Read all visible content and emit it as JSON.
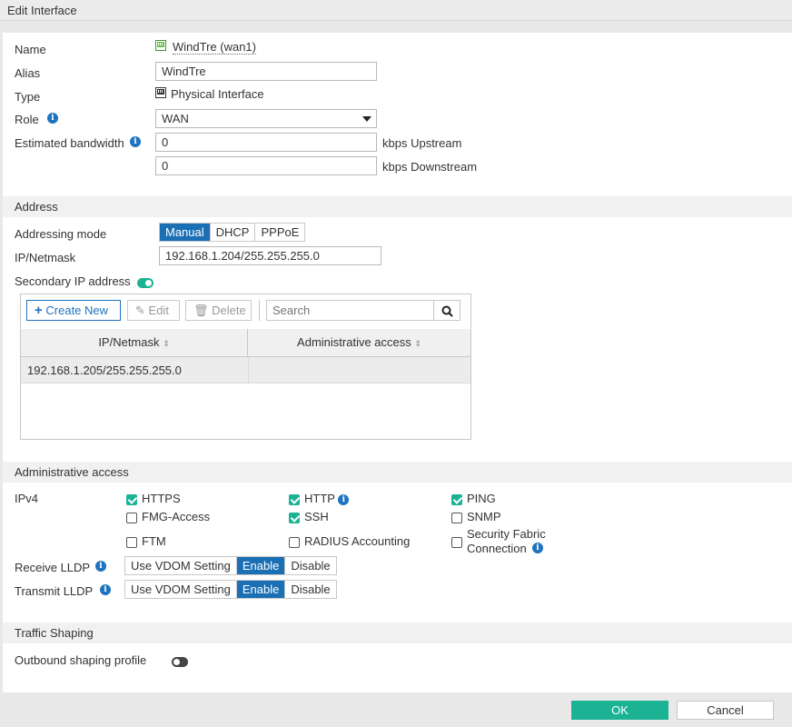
{
  "window": {
    "title": "Edit Interface"
  },
  "general": {
    "name_label": "Name",
    "name_value": "WindTre (wan1)",
    "alias_label": "Alias",
    "alias_value": "WindTre",
    "type_label": "Type",
    "type_value": "Physical Interface",
    "role_label": "Role",
    "role_value": "WAN",
    "bandwidth_label": "Estimated bandwidth",
    "upstream_value": "0",
    "upstream_unit": "kbps Upstream",
    "downstream_value": "0",
    "downstream_unit": "kbps Downstream"
  },
  "address": {
    "section_title": "Address",
    "mode_label": "Addressing mode",
    "modes": [
      "Manual",
      "DHCP",
      "PPPoE"
    ],
    "active_mode": "Manual",
    "ipnetmask_label": "IP/Netmask",
    "ipnetmask_value": "192.168.1.204/255.255.255.0",
    "secondary_label": "Secondary IP address",
    "secondary_enabled": true,
    "toolbar": {
      "create_new": "Create New",
      "edit": "Edit",
      "delete": "Delete",
      "search_placeholder": "Search"
    },
    "table": {
      "columns": [
        "IP/Netmask",
        "Administrative access"
      ],
      "rows": [
        {
          "ipnetmask": "192.168.1.205/255.255.255.0",
          "access": ""
        }
      ]
    }
  },
  "admin_access": {
    "section_title": "Administrative access",
    "ipv4_label": "IPv4",
    "options": [
      {
        "label": "HTTPS",
        "checked": true
      },
      {
        "label": "HTTP",
        "checked": true,
        "info": true
      },
      {
        "label": "PING",
        "checked": true
      },
      {
        "label": "FMG-Access",
        "checked": false
      },
      {
        "label": "SSH",
        "checked": true
      },
      {
        "label": "SNMP",
        "checked": false
      },
      {
        "label": "FTM",
        "checked": false
      },
      {
        "label": "RADIUS Accounting",
        "checked": false
      },
      {
        "label_line1": "Security Fabric",
        "label_line2": "Connection",
        "checked": false,
        "info": true
      }
    ],
    "receive_lldp_label": "Receive LLDP",
    "transmit_lldp_label": "Transmit LLDP",
    "lldp_options": [
      "Use VDOM Setting",
      "Enable",
      "Disable"
    ],
    "receive_lldp_selected": "Enable",
    "transmit_lldp_selected": "Enable"
  },
  "traffic_shaping": {
    "section_title": "Traffic Shaping",
    "outbound_label": "Outbound shaping profile",
    "outbound_enabled": false
  },
  "footer": {
    "ok": "OK",
    "cancel": "Cancel"
  },
  "colors": {
    "accent": "#1a6fb5",
    "toggle_on": "#1bb394",
    "ok_button": "#1bb394"
  }
}
